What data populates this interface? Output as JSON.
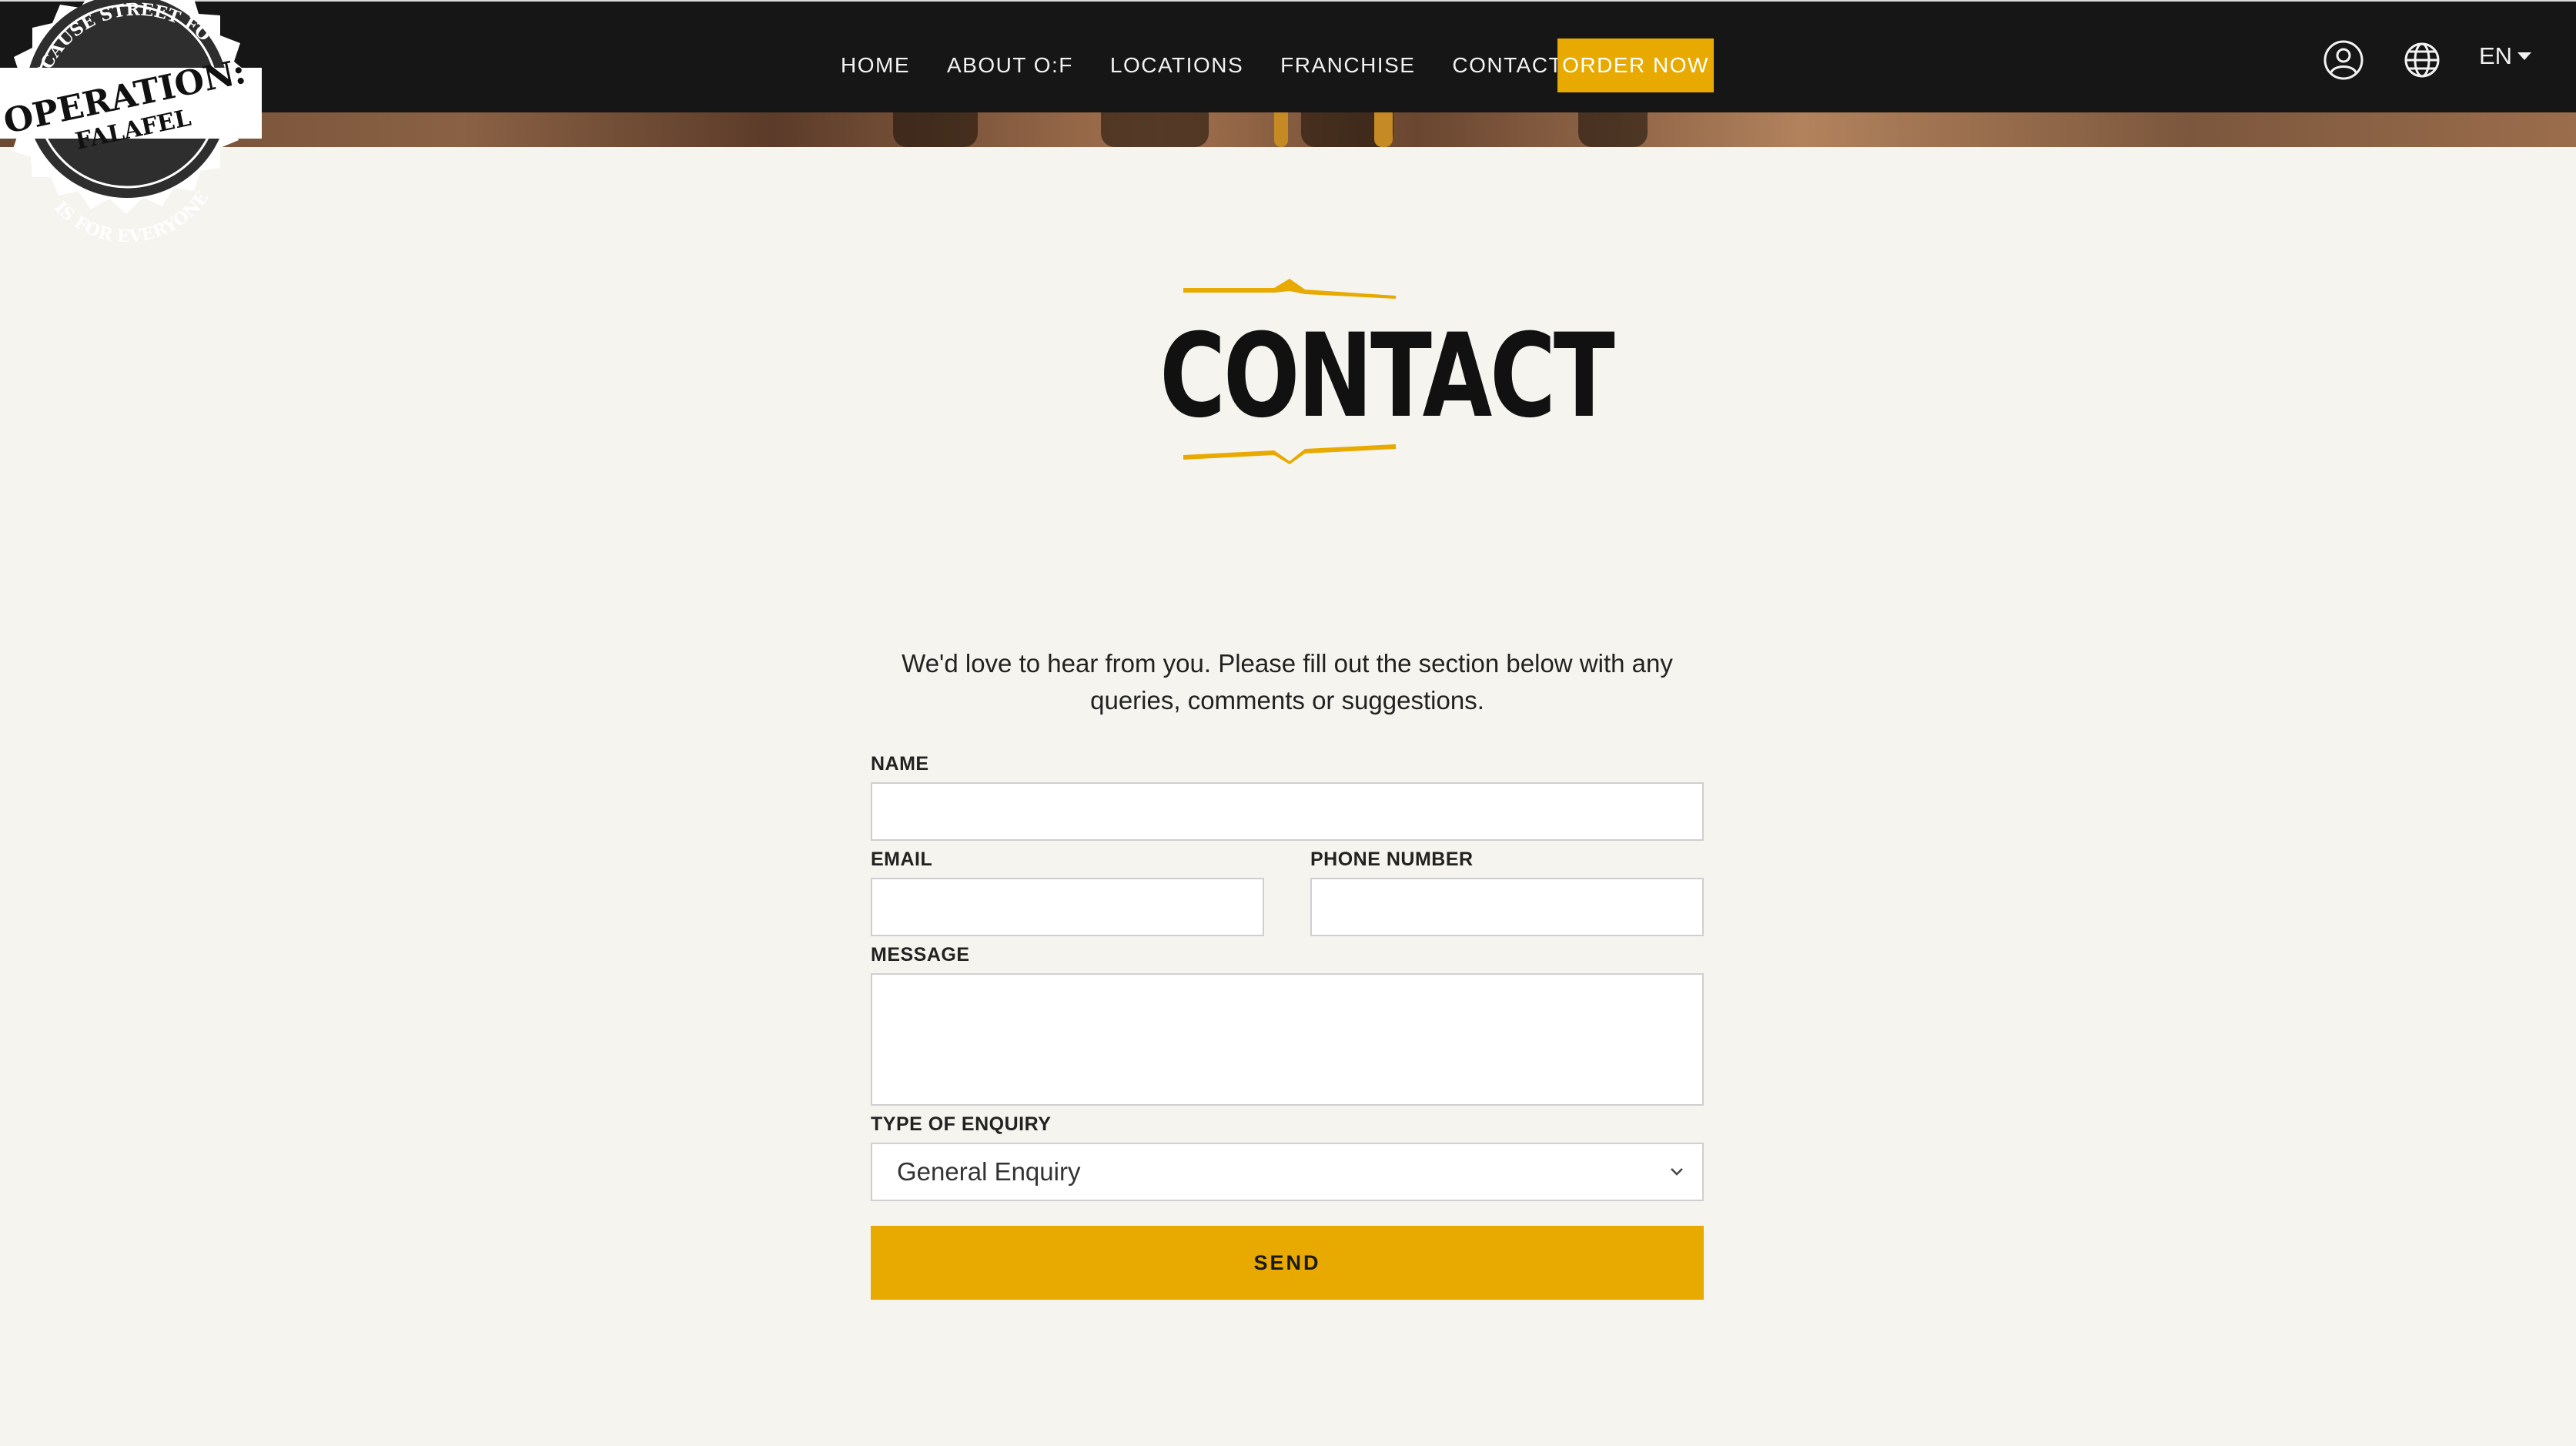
{
  "header": {
    "nav": [
      {
        "label": "HOME"
      },
      {
        "label": "ABOUT O:F"
      },
      {
        "label": "LOCATIONS"
      },
      {
        "label": "FRANCHISE"
      },
      {
        "label": "CONTACT"
      }
    ],
    "order_label": "ORDER NOW",
    "language": "EN",
    "icons": {
      "account": "user-circle-icon",
      "language": "globe-icon"
    }
  },
  "logo": {
    "top_text": "BECAUSE STREET FOOD",
    "main_text": "OPERATION:",
    "sub_text": "FALAFEL",
    "bottom_text": "IS FOR EVERYONE"
  },
  "page": {
    "title": "CONTACT",
    "intro": "We'd love to hear from you. Please fill out the section below with any queries, comments or suggestions."
  },
  "form": {
    "name_label": "NAME",
    "email_label": "EMAIL",
    "phone_label": "PHONE NUMBER",
    "message_label": "MESSAGE",
    "enquiry_label": "TYPE OF ENQUIRY",
    "enquiry_value": "General Enquiry",
    "send_label": "SEND"
  },
  "colors": {
    "accent": "#e8aa00",
    "header_bg": "#161616",
    "page_bg": "#f5f4ef"
  }
}
